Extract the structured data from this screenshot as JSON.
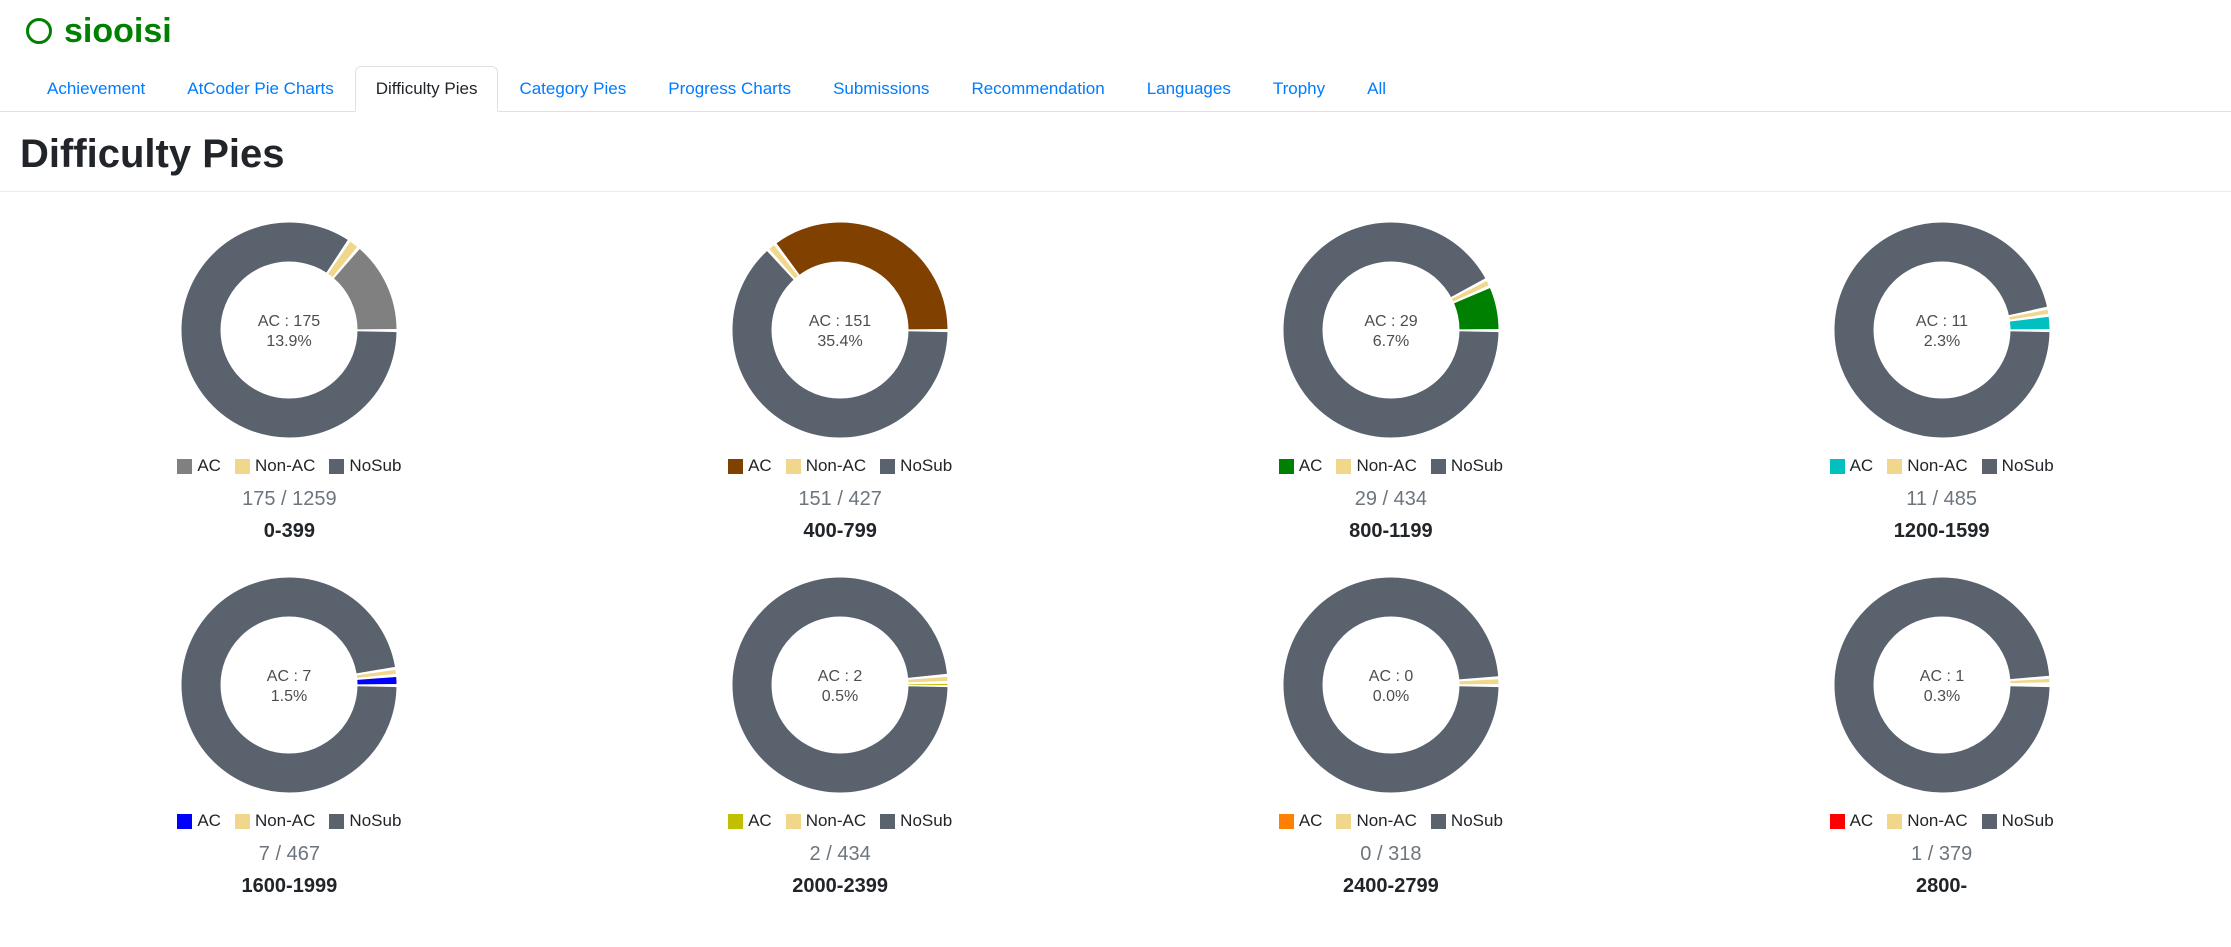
{
  "user": {
    "name": "siooisi",
    "color": "#008000"
  },
  "tabs": [
    {
      "label": "Achievement",
      "active": false
    },
    {
      "label": "AtCoder Pie Charts",
      "active": false
    },
    {
      "label": "Difficulty Pies",
      "active": true
    },
    {
      "label": "Category Pies",
      "active": false
    },
    {
      "label": "Progress Charts",
      "active": false
    },
    {
      "label": "Submissions",
      "active": false
    },
    {
      "label": "Recommendation",
      "active": false
    },
    {
      "label": "Languages",
      "active": false
    },
    {
      "label": "Trophy",
      "active": false
    },
    {
      "label": "All",
      "active": false
    }
  ],
  "page": {
    "title": "Difficulty Pies"
  },
  "legend": {
    "ac": "AC",
    "non_ac": "Non-AC",
    "no_sub": "NoSub"
  },
  "colors": {
    "user_green": "#008000",
    "link_blue": "#007bff",
    "non_ac": "#f0d78c",
    "no_sub": "#5a626e"
  },
  "chart_data": [
    {
      "type": "donut",
      "title": "0-399",
      "center_ac": "AC : 175",
      "center_pct": "13.9%",
      "count_label": "175 / 1259",
      "ac": 175,
      "total": 1259,
      "ac_pct": 13.9,
      "non_ac_pct_est": 1.6,
      "ac_color": "#808080"
    },
    {
      "type": "donut",
      "title": "400-799",
      "center_ac": "AC : 151",
      "center_pct": "35.4%",
      "count_label": "151 / 427",
      "ac": 151,
      "total": 427,
      "ac_pct": 35.4,
      "non_ac_pct_est": 1.2,
      "ac_color": "#804000"
    },
    {
      "type": "donut",
      "title": "800-1199",
      "center_ac": "AC : 29",
      "center_pct": "6.7%",
      "count_label": "29 / 434",
      "ac": 29,
      "total": 434,
      "ac_pct": 6.7,
      "non_ac_pct_est": 1.0,
      "ac_color": "#008000"
    },
    {
      "type": "donut",
      "title": "1200-1599",
      "center_ac": "AC : 11",
      "center_pct": "2.3%",
      "count_label": "11 / 485",
      "ac": 11,
      "total": 485,
      "ac_pct": 2.3,
      "non_ac_pct_est": 0.9,
      "ac_color": "#00c0c0"
    },
    {
      "type": "donut",
      "title": "1600-1999",
      "center_ac": "AC : 7",
      "center_pct": "1.5%",
      "count_label": "7 / 467",
      "ac": 7,
      "total": 467,
      "ac_pct": 1.5,
      "non_ac_pct_est": 0.9,
      "ac_color": "#0000ff"
    },
    {
      "type": "donut",
      "title": "2000-2399",
      "center_ac": "AC : 2",
      "center_pct": "0.5%",
      "count_label": "2 / 434",
      "ac": 2,
      "total": 434,
      "ac_pct": 0.5,
      "non_ac_pct_est": 0.9,
      "ac_color": "#c0c000"
    },
    {
      "type": "donut",
      "title": "2400-2799",
      "center_ac": "AC : 0",
      "center_pct": "0.0%",
      "count_label": "0 / 318",
      "ac": 0,
      "total": 318,
      "ac_pct": 0.0,
      "non_ac_pct_est": 1.0,
      "ac_color": "#ff8000"
    },
    {
      "type": "donut",
      "title": "2800-",
      "center_ac": "AC : 1",
      "center_pct": "0.3%",
      "count_label": "1 / 379",
      "ac": 1,
      "total": 379,
      "ac_pct": 0.3,
      "non_ac_pct_est": 0.8,
      "ac_color": "#ff0000"
    }
  ]
}
